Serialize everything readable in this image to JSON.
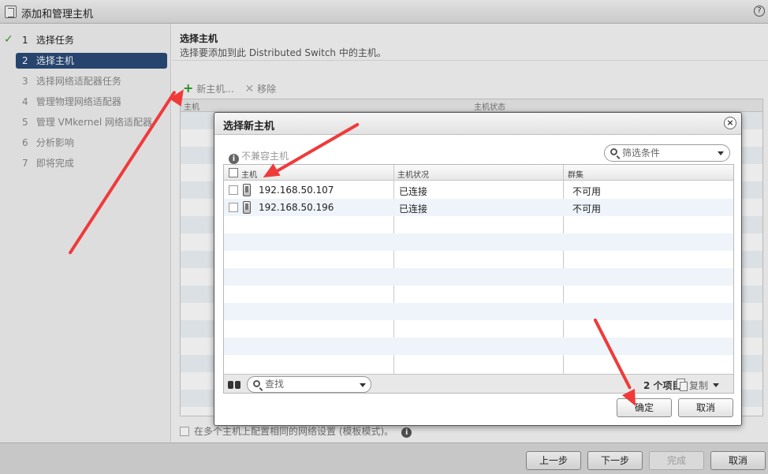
{
  "window": {
    "title": "添加和管理主机",
    "help": "?"
  },
  "steps": [
    {
      "num": "1",
      "label": "选择任务",
      "state": "done"
    },
    {
      "num": "2",
      "label": "选择主机",
      "state": "active"
    },
    {
      "num": "3",
      "label": "选择网络适配器任务",
      "state": "pending"
    },
    {
      "num": "4",
      "label": "管理物理网络适配器",
      "state": "pending"
    },
    {
      "num": "5",
      "label": "管理 VMkernel 网络适配器",
      "state": "pending"
    },
    {
      "num": "6",
      "label": "分析影响",
      "state": "pending"
    },
    {
      "num": "7",
      "label": "即将完成",
      "state": "pending"
    }
  ],
  "main": {
    "heading": "选择主机",
    "subheading": "选择要添加到此 Distributed Switch 中的主机。",
    "toolbar": {
      "new_host": "新主机...",
      "remove": "移除"
    },
    "table_headers": {
      "host": "主机",
      "status": "主机状态"
    },
    "footer_checkbox": "在多个主机上配置相同的网络设置 (模板模式)。"
  },
  "buttons": {
    "back": "上一步",
    "next": "下一步",
    "finish": "完成",
    "cancel": "取消"
  },
  "dialog": {
    "title": "选择新主机",
    "incompatible": "不兼容主机",
    "filter_placeholder": "筛选条件",
    "columns": {
      "host": "主机",
      "status": "主机状况",
      "cluster": "群集"
    },
    "rows": [
      {
        "host": "192.168.50.107",
        "status": "已连接",
        "cluster": "不可用"
      },
      {
        "host": "192.168.50.196",
        "status": "已连接",
        "cluster": "不可用"
      }
    ],
    "search_placeholder": "查找",
    "count": "2 个项目",
    "copy": "复制",
    "ok": "确定",
    "cancel": "取消"
  },
  "colors": {
    "active_step": "#2a4a78",
    "annotation_arrow": "#f03a3a",
    "row_alt": "#eef4fa"
  }
}
